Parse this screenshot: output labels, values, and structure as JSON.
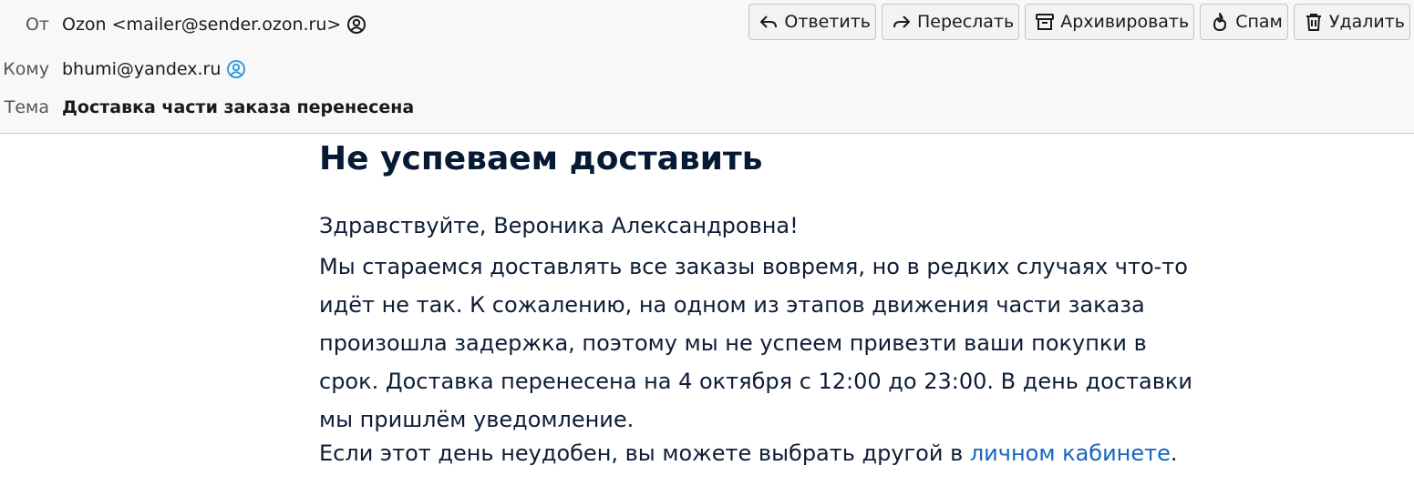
{
  "header": {
    "from_label": "От",
    "from_value": "Ozon <mailer@sender.ozon.ru>",
    "to_label": "Кому",
    "to_value": "bhumi@yandex.ru",
    "subject_label": "Тема",
    "subject_value": "Доставка части заказа перенесена",
    "contact_icon_color": "#3a9ae0"
  },
  "toolbar": {
    "reply": "Ответить",
    "forward": "Переслать",
    "archive": "Архивировать",
    "spam": "Спам",
    "delete": "Удалить"
  },
  "message": {
    "headline": "Не успеваем доставить",
    "greeting": "Здравствуйте, Вероника Александровна!",
    "lines": [
      "Мы стараемся доставлять все заказы вовремя, но в редких случаях что-то",
      "идёт не так. К сожалению, на одном из этапов движения части заказа",
      "произошла задержка, поэтому мы не успеем привезти ваши покупки в",
      "срок. Доставка перенесена на 4 октября с 12:00 до 23:00. В день доставки",
      "мы пришлём уведомление."
    ],
    "closing_prefix": "Если этот день неудобен, вы можете выбрать другой в ",
    "closing_link": "личном кабинете",
    "closing_suffix": ".",
    "link_color": "#1565c0"
  }
}
